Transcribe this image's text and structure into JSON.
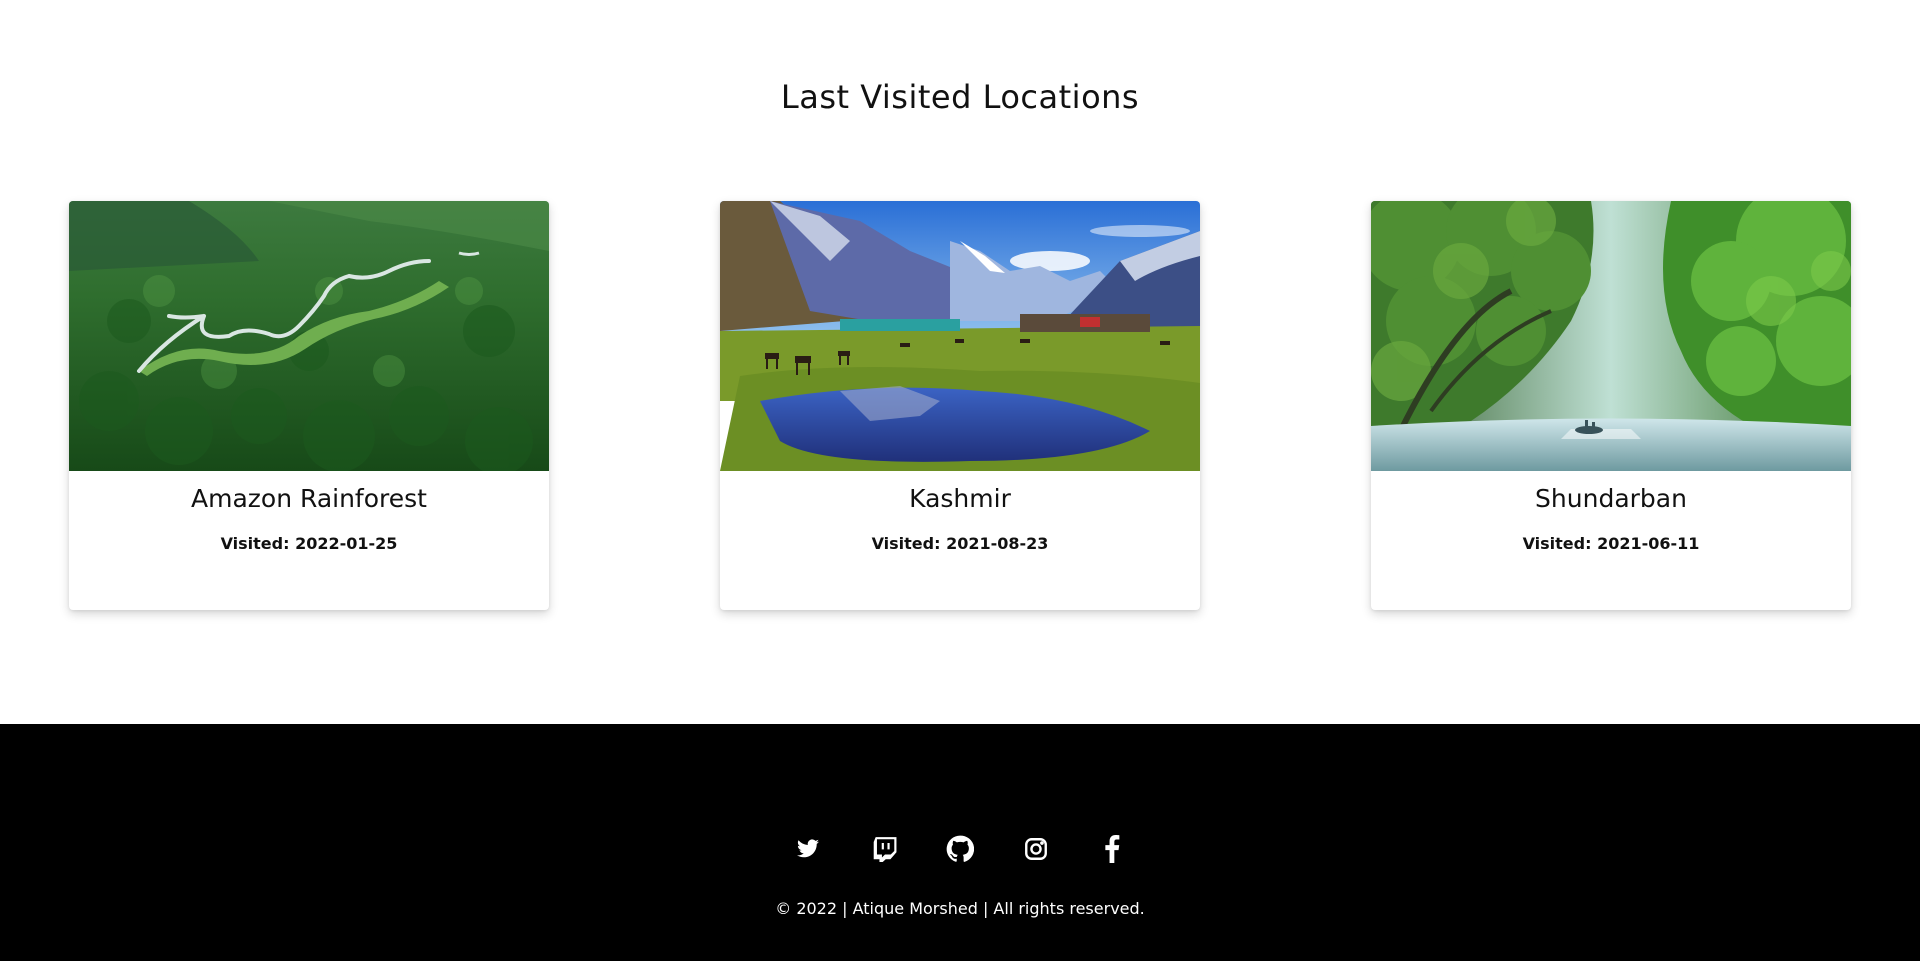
{
  "section": {
    "title": "Last Visited Locations"
  },
  "cards": [
    {
      "title": "Amazon Rainforest",
      "visited": "Visited: 2022-01-25"
    },
    {
      "title": "Kashmir",
      "visited": "Visited: 2021-08-23"
    },
    {
      "title": "Shundarban",
      "visited": "Visited: 2021-06-11"
    }
  ],
  "footer": {
    "social": [
      "twitter-icon",
      "twitch-icon",
      "github-icon",
      "instagram-icon",
      "facebook-icon"
    ],
    "copyright": "© 2022 | Atique Morshed | All rights reserved.",
    "background": "#000000",
    "text_color": "#ffffff"
  }
}
